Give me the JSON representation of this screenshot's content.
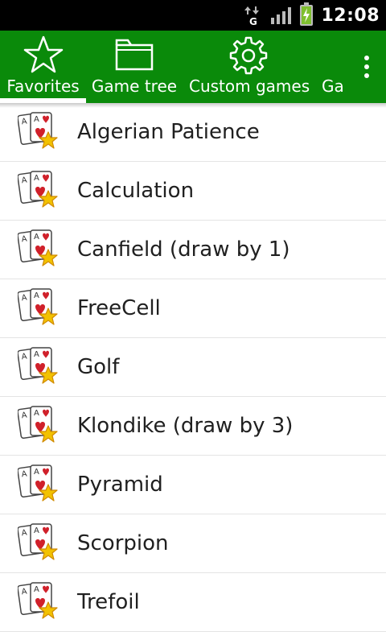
{
  "status_bar": {
    "time": "12:08",
    "network_icon": "data-transfer-g-icon",
    "signal_icon": "signal-bars-icon",
    "battery_icon": "battery-charging-icon"
  },
  "tabs": [
    {
      "label": "Favorites",
      "icon": "star-icon",
      "selected": true
    },
    {
      "label": "Game tree",
      "icon": "folder-icon",
      "selected": false
    },
    {
      "label": "Custom games",
      "icon": "gear-icon",
      "selected": false
    },
    {
      "label": "Ga",
      "icon": "partial-icon",
      "selected": false
    }
  ],
  "colors": {
    "accent": "#0a8a0a",
    "text": "#202020"
  },
  "games": [
    "Algerian Patience",
    "Calculation",
    "Canfield (draw by 1)",
    "FreeCell",
    "Golf",
    "Klondike (draw by 3)",
    "Pyramid",
    "Scorpion",
    "Trefoil"
  ]
}
